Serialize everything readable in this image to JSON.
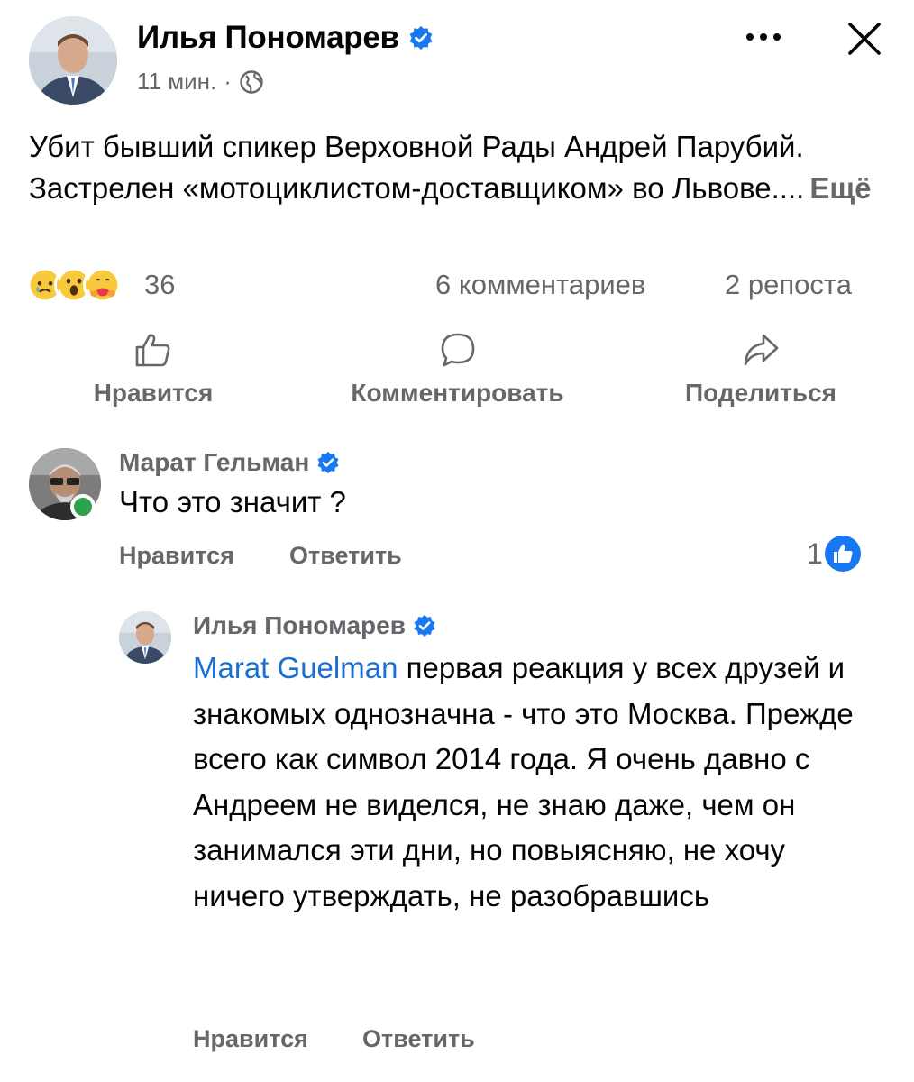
{
  "post": {
    "author": "Илья Пономарев",
    "time": "11 мин.",
    "separator": "·",
    "text": "Убит бывший спикер Верховной Рады Андрей Парубий. Застрелен «мотоциклистом-доставщиком» во Львове....",
    "see_more": "Ещё",
    "reaction_count": "36",
    "comments_count": "6 комментариев",
    "shares_count": "2 репоста",
    "reactions": [
      "sad-emoji",
      "wow-emoji",
      "care-emoji"
    ]
  },
  "actions": {
    "like": "Нравится",
    "comment": "Комментировать",
    "share": "Поделиться"
  },
  "comment": {
    "author": "Марат Гельман",
    "text": "Что это значит ?",
    "like": "Нравится",
    "reply": "Ответить",
    "like_count": "1"
  },
  "reply": {
    "author": "Илья Пономарев",
    "mention": "Marat Guelman",
    "text": "первая реакция у всех друзей и знакомых однозначна - что это Москва. Прежде всего как символ 2014 года. Я очень давно с Андреем не виделся, не знаю даже, чем он занимался эти дни, но повыясняю, не хочу ничего утверждать, не разобравшись",
    "like": "Нравится",
    "reply": "Ответить"
  },
  "colors": {
    "verified": "#1877f2",
    "secondary_text": "#65676b",
    "mention": "#1b6fd1",
    "online": "#31a24c"
  }
}
